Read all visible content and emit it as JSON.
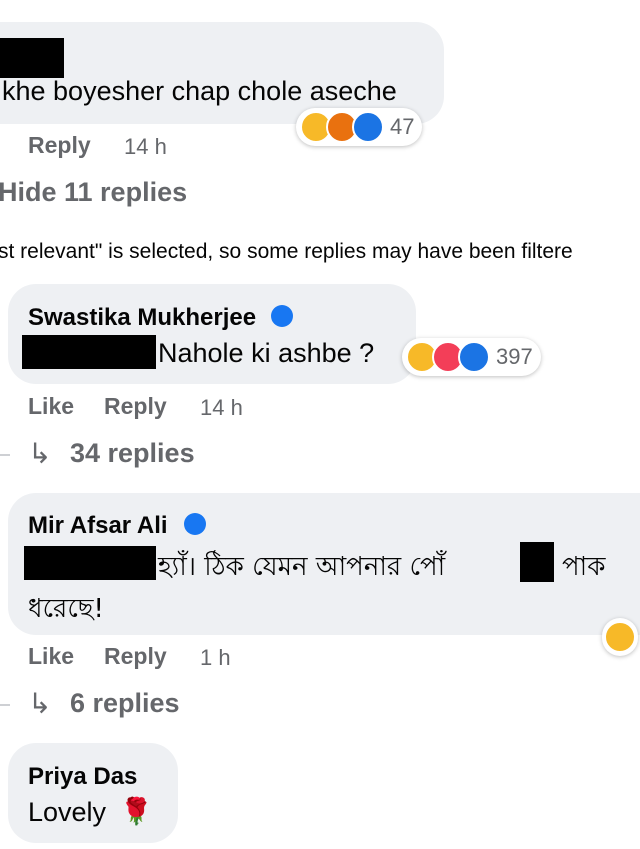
{
  "comment1": {
    "text": "khe boyesher chap chole aseche",
    "reply_label": "Reply",
    "time": "14 h",
    "reaction_count": "47",
    "reactions": [
      "haha-icon",
      "angry-icon",
      "like-icon"
    ]
  },
  "hide_replies": "Hide 11 replies",
  "filter_note": "st relevant\" is selected, so some replies may have been filtere",
  "reply1": {
    "author": "Swastika Mukherjee",
    "text": "Nahole ki ashbe ?",
    "like_label": "Like",
    "reply_label": "Reply",
    "time": "14 h",
    "reaction_count": "397",
    "replies_link": "34 replies"
  },
  "reply2": {
    "author": "Mir Afsar Ali",
    "text_line1_a": "হ্যাঁ। ঠিক যেমন আপনার পোঁ",
    "text_line1_b": "পাক",
    "text_line2": "ধরেছে!",
    "like_label": "Like",
    "reply_label": "Reply",
    "time": "1 h",
    "replies_link": "6 replies"
  },
  "reply3": {
    "author": "Priya Das",
    "text": "Lovely",
    "emoji": "🌹"
  },
  "colors": {
    "bubble": "#eef0f3",
    "muted": "#65676b",
    "verified": "#1877f2"
  }
}
